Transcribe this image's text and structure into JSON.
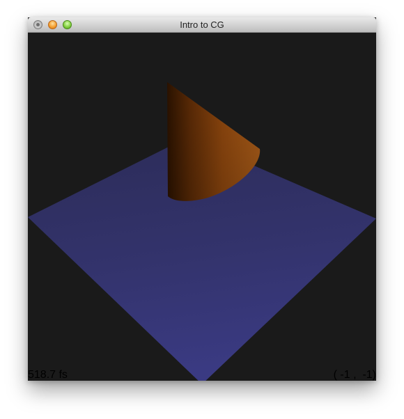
{
  "window": {
    "title": "Intro to CG"
  },
  "hud": {
    "fps_text": "518.7 fs",
    "coords_text": "( -1 ,  -1)"
  },
  "scene": {
    "background_color": "#1a1a1a",
    "plane_color": "#3a3a80",
    "cone_color": "#8a4410",
    "objects": [
      "plane",
      "cone"
    ]
  }
}
